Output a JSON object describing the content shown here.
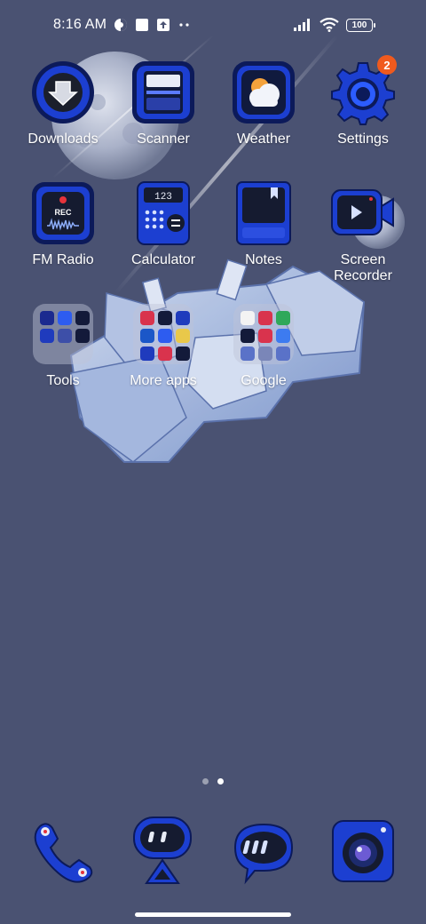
{
  "status_bar": {
    "time": "8:16 AM",
    "battery": "100",
    "left_icons": [
      "vpn-icon",
      "square-notification-icon",
      "upload-icon",
      "more-dots-icon"
    ],
    "right_icons": [
      "signal-icon",
      "wifi-icon",
      "battery-icon"
    ]
  },
  "apps": [
    {
      "id": "downloads",
      "label": "Downloads",
      "icon": "downloads-icon"
    },
    {
      "id": "scanner",
      "label": "Scanner",
      "icon": "scanner-icon"
    },
    {
      "id": "weather",
      "label": "Weather",
      "icon": "weather-icon"
    },
    {
      "id": "settings",
      "label": "Settings",
      "icon": "settings-icon",
      "badge": "2"
    },
    {
      "id": "fm-radio",
      "label": "FM Radio",
      "icon": "fm-radio-icon",
      "rec_text": "REC"
    },
    {
      "id": "calculator",
      "label": "Calculator",
      "icon": "calculator-icon",
      "display_text": "123"
    },
    {
      "id": "notes",
      "label": "Notes",
      "icon": "notes-icon"
    },
    {
      "id": "screen-recorder",
      "label": "Screen\nRecorder",
      "icon": "screen-recorder-icon"
    }
  ],
  "folders": [
    {
      "id": "tools",
      "label": "Tools"
    },
    {
      "id": "more-apps",
      "label": "More apps"
    },
    {
      "id": "google",
      "label": "Google"
    }
  ],
  "pages": {
    "count": 2,
    "active": 2
  },
  "dock": [
    {
      "id": "phone",
      "icon": "phone-icon"
    },
    {
      "id": "robot",
      "icon": "robot-app-icon"
    },
    {
      "id": "messages",
      "icon": "messages-icon"
    },
    {
      "id": "camera",
      "icon": "camera-icon"
    }
  ],
  "colors": {
    "background": "#4a5272",
    "icon_blue": "#1c3fd1",
    "icon_dark": "#0c1a5a",
    "badge": "#f05a1e"
  }
}
